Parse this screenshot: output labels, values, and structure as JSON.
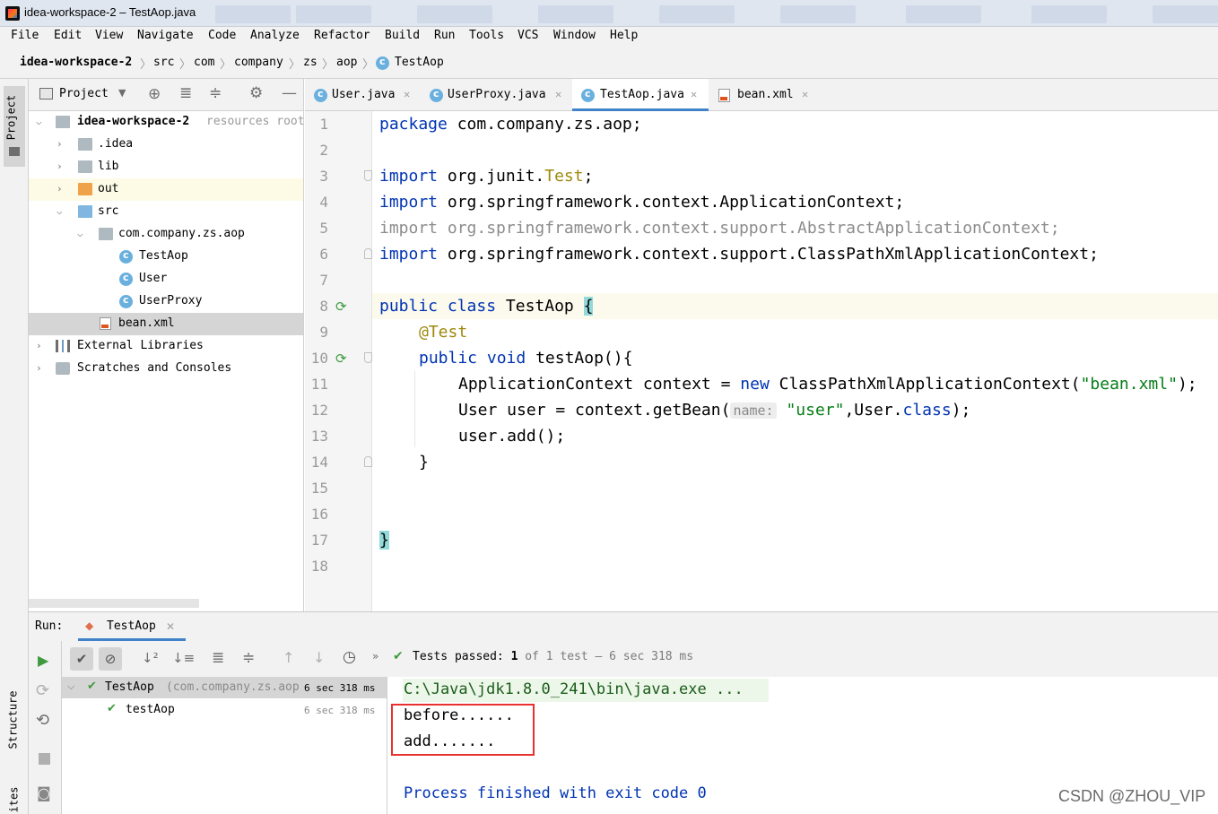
{
  "window": {
    "title": "idea-workspace-2 – TestAop.java"
  },
  "menu": [
    "File",
    "Edit",
    "View",
    "Navigate",
    "Code",
    "Analyze",
    "Refactor",
    "Build",
    "Run",
    "Tools",
    "VCS",
    "Window",
    "Help"
  ],
  "breadcrumb": [
    "idea-workspace-2",
    "src",
    "com",
    "company",
    "zs",
    "aop",
    "TestAop"
  ],
  "side_tabs": {
    "project": "Project",
    "structure": "Structure",
    "favorites": "ites"
  },
  "project_panel": {
    "title": "Project",
    "root": {
      "name": "idea-workspace-2",
      "hint": "resources root"
    },
    "items": [
      {
        "label": ".idea"
      },
      {
        "label": "lib"
      },
      {
        "label": "out"
      },
      {
        "label": "src"
      },
      {
        "label": "com.company.zs.aop"
      },
      {
        "label": "TestAop"
      },
      {
        "label": "User"
      },
      {
        "label": "UserProxy"
      },
      {
        "label": "bean.xml"
      },
      {
        "label": "External Libraries"
      },
      {
        "label": "Scratches and Consoles"
      }
    ]
  },
  "editor_tabs": [
    {
      "label": "User.java"
    },
    {
      "label": "UserProxy.java"
    },
    {
      "label": "TestAop.java",
      "active": true
    },
    {
      "label": "bean.xml"
    }
  ],
  "code": {
    "line_numbers": [
      "1",
      "2",
      "3",
      "4",
      "5",
      "6",
      "7",
      "8",
      "9",
      "10",
      "11",
      "12",
      "13",
      "14",
      "15",
      "16",
      "17",
      "18"
    ],
    "l1": {
      "kw": "package",
      "rest": " com.company.zs.aop;"
    },
    "l3": {
      "kw": "import",
      "a": " org.junit.",
      "b": "Test",
      "c": ";"
    },
    "l4": {
      "kw": "import",
      "rest": " org.springframework.context.ApplicationContext;"
    },
    "l5": {
      "text": "import org.springframework.context.support.AbstractApplicationContext;"
    },
    "l6": {
      "kw": "import",
      "rest": " org.springframework.context.support.ClassPathXmlApplicationContext;"
    },
    "l8": {
      "kw1": "public",
      "kw2": "class",
      "name": " TestAop ",
      "brace": "{"
    },
    "l9": {
      "ann": "@Test"
    },
    "l10": {
      "kw1": "public",
      "kw2": "void",
      "rest": " testAop(){"
    },
    "l11": {
      "a": "ApplicationContext context = ",
      "kw": "new",
      "b": " ClassPathXmlApplicationContext(",
      "str": "\"bean.xml\"",
      "c": ");"
    },
    "l12": {
      "a": "User user = context.getBean(",
      "hint": "name:",
      "str": "\"user\"",
      "b": ",User.",
      "kw": "class",
      "c": ");"
    },
    "l13": {
      "text": "user.add();"
    },
    "l14": {
      "text": "}"
    },
    "l17": {
      "text": "}"
    }
  },
  "run_panel": {
    "label": "Run:",
    "tab": "TestAop",
    "status_prefix": "Tests passed:",
    "passed": "1",
    "status_suffix": "of 1 test – 6 sec 318 ms",
    "tree": [
      {
        "name": "TestAop",
        "pkg": "(com.company.zs.aop",
        "time": "6 sec 318 ms"
      },
      {
        "name": "testAop",
        "time": "6 sec 318 ms"
      }
    ],
    "console": [
      "C:\\Java\\jdk1.8.0_241\\bin\\java.exe ...",
      "before......",
      "add.......",
      "",
      "Process finished with exit code 0"
    ]
  },
  "watermark": "CSDN @ZHOU_VIP",
  "colors": {
    "keyword": "#0033b3",
    "annotation": "#9e880d",
    "string": "#067d17",
    "accent": "#4083c9",
    "highlight_box": "#e8312f"
  }
}
